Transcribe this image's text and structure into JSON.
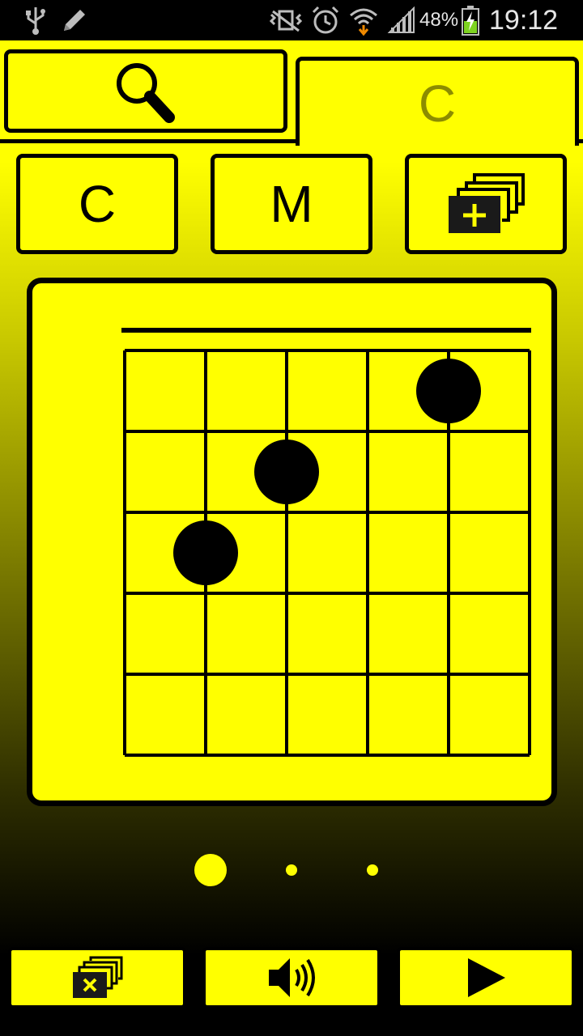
{
  "status_bar": {
    "time": "19:12",
    "battery": "48%",
    "icons": [
      "usb-icon",
      "pencil-icon",
      "vibrate-icon",
      "alarm-icon",
      "wifi-icon",
      "signal-icon",
      "battery-charging-icon"
    ]
  },
  "tabs": {
    "search_icon": "search-icon",
    "chord_tab_label": "C"
  },
  "controls": {
    "root_label": "C",
    "quality_label": "M",
    "add_icon": "add-to-collection-icon"
  },
  "chord_diagram": {
    "strings": 6,
    "frets": 5,
    "fingers": [
      {
        "string": 5,
        "fret": 1
      },
      {
        "string": 3,
        "fret": 2
      },
      {
        "string": 2,
        "fret": 3
      }
    ]
  },
  "pager": {
    "pages": 3,
    "active_page": 1
  },
  "bottom_bar": {
    "clear_icon": "clear-collection-icon",
    "sound_icon": "speaker-icon",
    "play_icon": "play-icon"
  },
  "colors": {
    "accent": "#ffff00",
    "ink": "#000000",
    "inactive_tab_text": "#8c8c00"
  }
}
